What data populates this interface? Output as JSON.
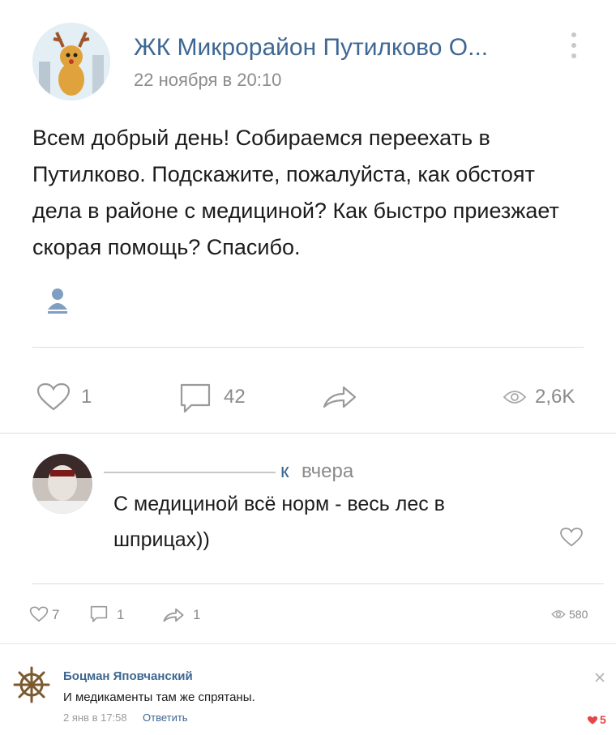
{
  "post": {
    "group_title": "ЖК Микрорайон Путилково О...",
    "date": "22 ноября в 20:10",
    "text": "Всем добрый день! Собираемся переехать в Путилково. Подскажите, пожалуйста, как обстоят дела в районе с медициной? Как быстро приезжает скорая помощь? Спасибо.",
    "likes": "1",
    "comments": "42",
    "views": "2,6K"
  },
  "comment": {
    "author_suffix": "к",
    "time": "вчера",
    "text": "С медициной всё норм - весь лес в шприцах))",
    "likes": "7",
    "replies": "1",
    "shares": "1",
    "views": "580"
  },
  "reply": {
    "author": "Боцман Яповчанский",
    "text": "И медикаменты там же спрятаны.",
    "date": "2 янв в 17:58",
    "answer_label": "Ответить",
    "likes": "5"
  },
  "colors": {
    "link": "#3e6793",
    "heart": "#e64646",
    "divider": "#dcdcdc"
  }
}
